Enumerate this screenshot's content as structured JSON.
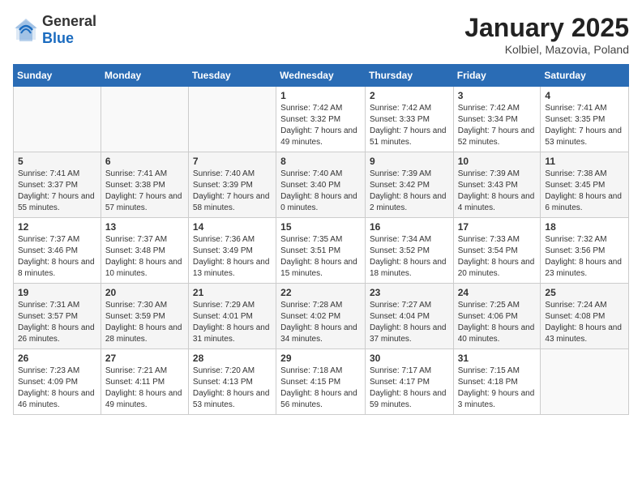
{
  "header": {
    "logo_general": "General",
    "logo_blue": "Blue",
    "title": "January 2025",
    "location": "Kolbiel, Mazovia, Poland"
  },
  "days_of_week": [
    "Sunday",
    "Monday",
    "Tuesday",
    "Wednesday",
    "Thursday",
    "Friday",
    "Saturday"
  ],
  "weeks": [
    [
      {
        "day": "",
        "info": ""
      },
      {
        "day": "",
        "info": ""
      },
      {
        "day": "",
        "info": ""
      },
      {
        "day": "1",
        "info": "Sunrise: 7:42 AM\nSunset: 3:32 PM\nDaylight: 7 hours and 49 minutes."
      },
      {
        "day": "2",
        "info": "Sunrise: 7:42 AM\nSunset: 3:33 PM\nDaylight: 7 hours and 51 minutes."
      },
      {
        "day": "3",
        "info": "Sunrise: 7:42 AM\nSunset: 3:34 PM\nDaylight: 7 hours and 52 minutes."
      },
      {
        "day": "4",
        "info": "Sunrise: 7:41 AM\nSunset: 3:35 PM\nDaylight: 7 hours and 53 minutes."
      }
    ],
    [
      {
        "day": "5",
        "info": "Sunrise: 7:41 AM\nSunset: 3:37 PM\nDaylight: 7 hours and 55 minutes."
      },
      {
        "day": "6",
        "info": "Sunrise: 7:41 AM\nSunset: 3:38 PM\nDaylight: 7 hours and 57 minutes."
      },
      {
        "day": "7",
        "info": "Sunrise: 7:40 AM\nSunset: 3:39 PM\nDaylight: 7 hours and 58 minutes."
      },
      {
        "day": "8",
        "info": "Sunrise: 7:40 AM\nSunset: 3:40 PM\nDaylight: 8 hours and 0 minutes."
      },
      {
        "day": "9",
        "info": "Sunrise: 7:39 AM\nSunset: 3:42 PM\nDaylight: 8 hours and 2 minutes."
      },
      {
        "day": "10",
        "info": "Sunrise: 7:39 AM\nSunset: 3:43 PM\nDaylight: 8 hours and 4 minutes."
      },
      {
        "day": "11",
        "info": "Sunrise: 7:38 AM\nSunset: 3:45 PM\nDaylight: 8 hours and 6 minutes."
      }
    ],
    [
      {
        "day": "12",
        "info": "Sunrise: 7:37 AM\nSunset: 3:46 PM\nDaylight: 8 hours and 8 minutes."
      },
      {
        "day": "13",
        "info": "Sunrise: 7:37 AM\nSunset: 3:48 PM\nDaylight: 8 hours and 10 minutes."
      },
      {
        "day": "14",
        "info": "Sunrise: 7:36 AM\nSunset: 3:49 PM\nDaylight: 8 hours and 13 minutes."
      },
      {
        "day": "15",
        "info": "Sunrise: 7:35 AM\nSunset: 3:51 PM\nDaylight: 8 hours and 15 minutes."
      },
      {
        "day": "16",
        "info": "Sunrise: 7:34 AM\nSunset: 3:52 PM\nDaylight: 8 hours and 18 minutes."
      },
      {
        "day": "17",
        "info": "Sunrise: 7:33 AM\nSunset: 3:54 PM\nDaylight: 8 hours and 20 minutes."
      },
      {
        "day": "18",
        "info": "Sunrise: 7:32 AM\nSunset: 3:56 PM\nDaylight: 8 hours and 23 minutes."
      }
    ],
    [
      {
        "day": "19",
        "info": "Sunrise: 7:31 AM\nSunset: 3:57 PM\nDaylight: 8 hours and 26 minutes."
      },
      {
        "day": "20",
        "info": "Sunrise: 7:30 AM\nSunset: 3:59 PM\nDaylight: 8 hours and 28 minutes."
      },
      {
        "day": "21",
        "info": "Sunrise: 7:29 AM\nSunset: 4:01 PM\nDaylight: 8 hours and 31 minutes."
      },
      {
        "day": "22",
        "info": "Sunrise: 7:28 AM\nSunset: 4:02 PM\nDaylight: 8 hours and 34 minutes."
      },
      {
        "day": "23",
        "info": "Sunrise: 7:27 AM\nSunset: 4:04 PM\nDaylight: 8 hours and 37 minutes."
      },
      {
        "day": "24",
        "info": "Sunrise: 7:25 AM\nSunset: 4:06 PM\nDaylight: 8 hours and 40 minutes."
      },
      {
        "day": "25",
        "info": "Sunrise: 7:24 AM\nSunset: 4:08 PM\nDaylight: 8 hours and 43 minutes."
      }
    ],
    [
      {
        "day": "26",
        "info": "Sunrise: 7:23 AM\nSunset: 4:09 PM\nDaylight: 8 hours and 46 minutes."
      },
      {
        "day": "27",
        "info": "Sunrise: 7:21 AM\nSunset: 4:11 PM\nDaylight: 8 hours and 49 minutes."
      },
      {
        "day": "28",
        "info": "Sunrise: 7:20 AM\nSunset: 4:13 PM\nDaylight: 8 hours and 53 minutes."
      },
      {
        "day": "29",
        "info": "Sunrise: 7:18 AM\nSunset: 4:15 PM\nDaylight: 8 hours and 56 minutes."
      },
      {
        "day": "30",
        "info": "Sunrise: 7:17 AM\nSunset: 4:17 PM\nDaylight: 8 hours and 59 minutes."
      },
      {
        "day": "31",
        "info": "Sunrise: 7:15 AM\nSunset: 4:18 PM\nDaylight: 9 hours and 3 minutes."
      },
      {
        "day": "",
        "info": ""
      }
    ]
  ]
}
